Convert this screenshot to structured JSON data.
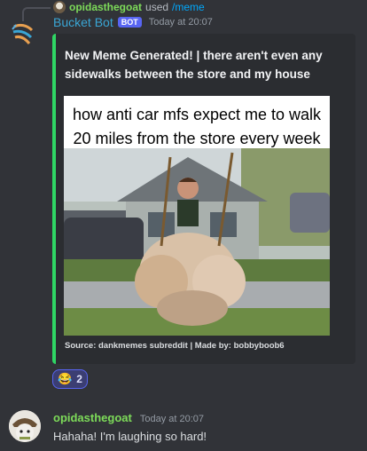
{
  "reply": {
    "username": "opidasthegoat",
    "used_text": "used",
    "command": "/meme"
  },
  "bot_message": {
    "author": "Bucket Bot",
    "tag": "BOT",
    "timestamp": "Today at 20:07",
    "embed": {
      "accent_color": "#2fd664",
      "title": "New Meme Generated! | there aren't even any sidewalks between the store and my house",
      "meme_caption_line1": "how anti car mfs expect me to walk",
      "meme_caption_line2": "20 miles from the store every week",
      "footer": "Source: dankmemes subreddit | Made by: bobbyboob6"
    },
    "reaction": {
      "emoji": "😂",
      "count": "2"
    }
  },
  "user_message": {
    "author": "opidasthegoat",
    "timestamp": "Today at 20:07",
    "text": "Hahaha! I'm laughing so hard!"
  }
}
